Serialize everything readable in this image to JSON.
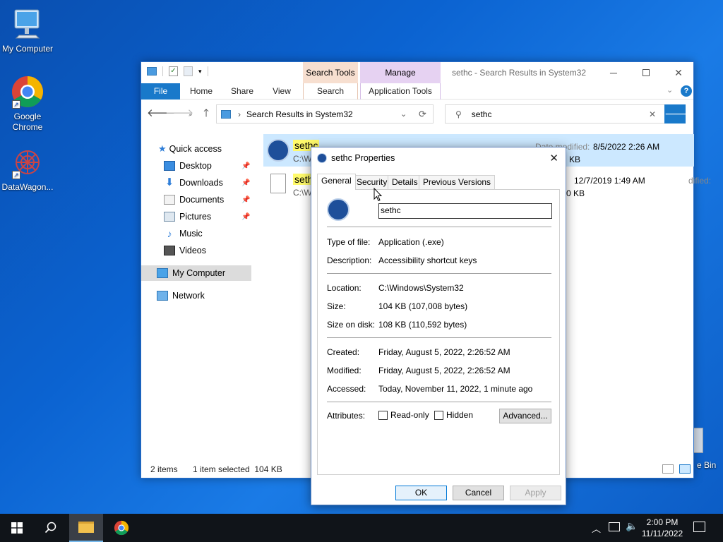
{
  "desktop": {
    "icons": [
      {
        "label": "My Computer"
      },
      {
        "label": "Google Chrome"
      },
      {
        "label": "DataWagon..."
      }
    ],
    "recycle_partial": "e Bin"
  },
  "explorer": {
    "title": "sethc - Search Results in System32",
    "context_tabs": {
      "search_tools": "Search Tools",
      "manage": "Manage"
    },
    "ribbon_tabs": [
      "File",
      "Home",
      "Share",
      "View",
      "Search",
      "Application Tools"
    ],
    "address": "Search Results in System32",
    "search_value": "sethc",
    "nav": {
      "quick_access": "Quick access",
      "items": [
        "Desktop",
        "Downloads",
        "Documents",
        "Pictures",
        "Music",
        "Videos"
      ],
      "my_computer": "My Computer",
      "network": "Network"
    },
    "files": [
      {
        "name": "sethc",
        "path": "C:\\W",
        "date_label": "Date modified:",
        "date": "8/5/2022 2:26 AM",
        "size": "KB"
      },
      {
        "name": "seth",
        "path": "C:\\W",
        "date_label": "dified:",
        "date": "12/7/2019 1:49 AM",
        "size": "0 KB"
      }
    ],
    "status": {
      "count": "2 items",
      "selected": "1 item selected  104 KB"
    }
  },
  "dialog": {
    "title": "sethc Properties",
    "tabs": [
      "General",
      "Security",
      "Details",
      "Previous Versions"
    ],
    "filename": "sethc",
    "labels": {
      "type": "Type of file:",
      "description": "Description:",
      "location": "Location:",
      "size": "Size:",
      "size_on_disk": "Size on disk:",
      "created": "Created:",
      "modified": "Modified:",
      "accessed": "Accessed:",
      "attributes": "Attributes:"
    },
    "values": {
      "type": "Application (.exe)",
      "description": "Accessibility shortcut keys",
      "location": "C:\\Windows\\System32",
      "size": "104 KB (107,008 bytes)",
      "size_on_disk": "108 KB (110,592 bytes)",
      "created": "Friday, August 5, 2022, 2:26:52 AM",
      "modified": "Friday, August 5, 2022, 2:26:52 AM",
      "accessed": "Today, November 11, 2022, 1 minute ago"
    },
    "attr": {
      "readonly": "Read-only",
      "hidden": "Hidden",
      "advanced": "Advanced..."
    },
    "buttons": {
      "ok": "OK",
      "cancel": "Cancel",
      "apply": "Apply"
    }
  },
  "taskbar": {
    "time": "2:00 PM",
    "date": "11/11/2022"
  },
  "colors": {
    "accent": "#1979ca",
    "search_tools": "#f7dfd0",
    "manage": "#e6d2f2",
    "selected_row": "#cce8ff",
    "highlight": "#fffa6b"
  }
}
